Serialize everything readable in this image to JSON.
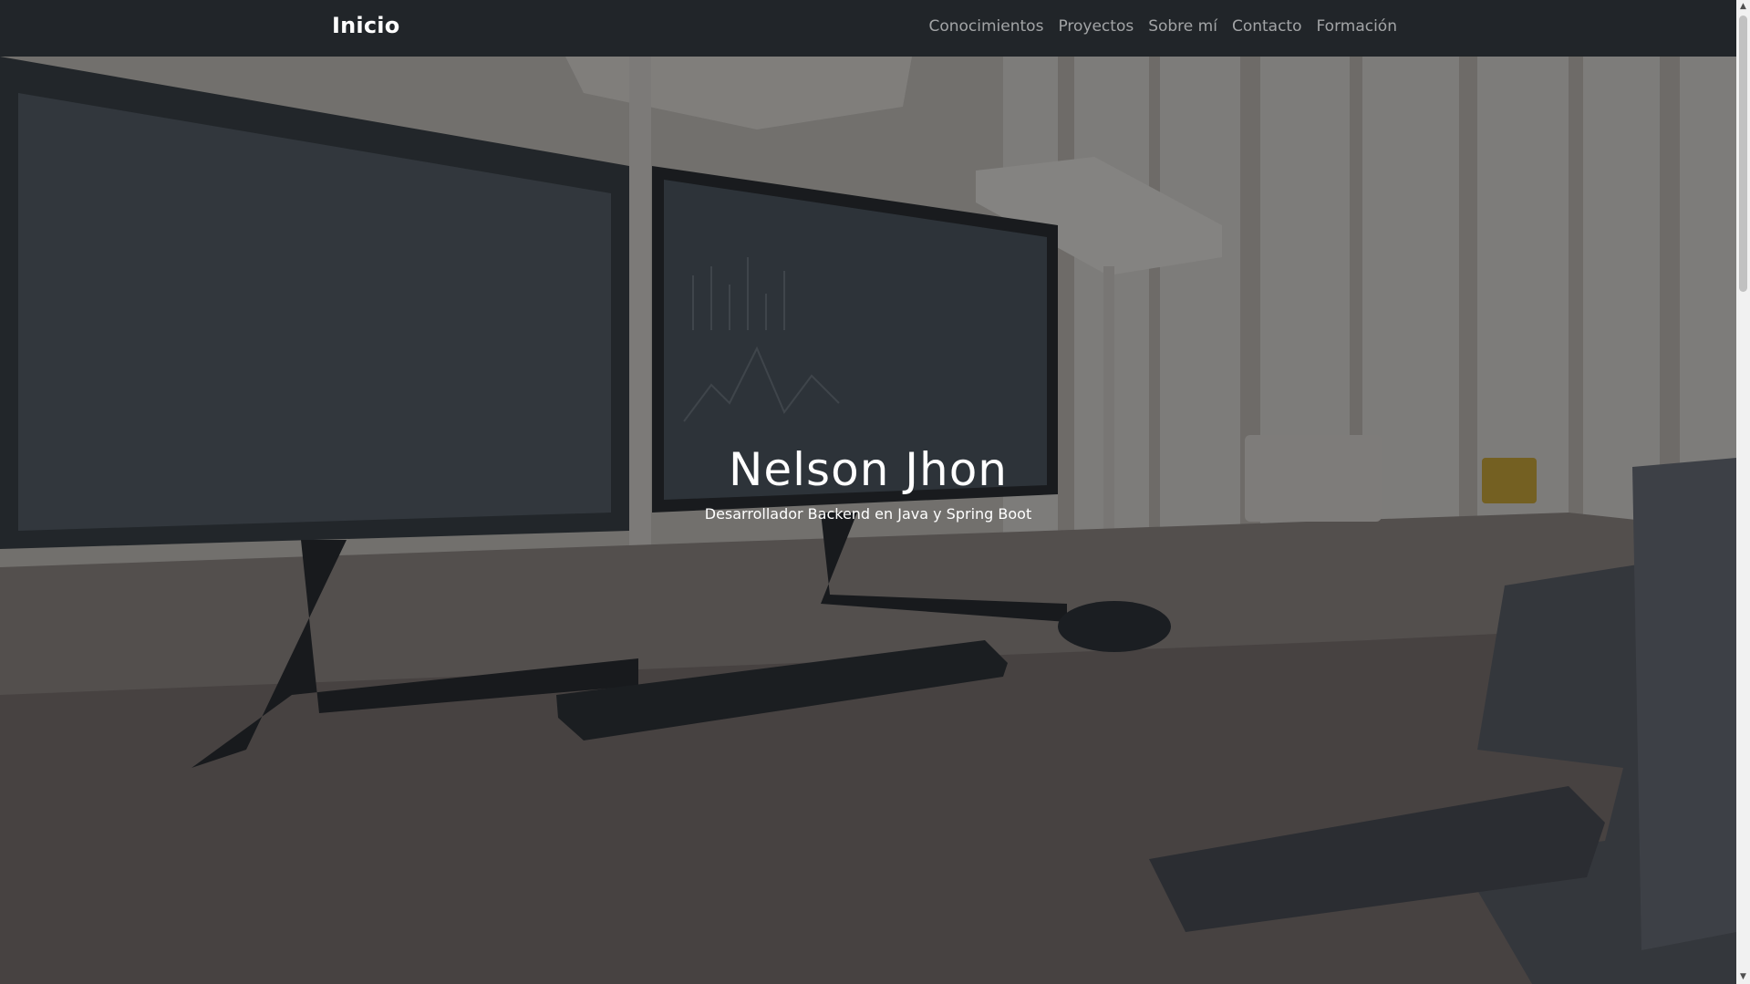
{
  "navbar": {
    "brand": "Inicio",
    "links": [
      "Conocimientos",
      "Proyectos",
      "Sobre mí",
      "Contacto",
      "Formación"
    ]
  },
  "hero": {
    "title": "Nelson Jhon",
    "subtitle": "Desarrollador Backend en Java y Spring Boot",
    "background_description_icon": "office-desk-photo"
  },
  "colors": {
    "navbar_bg": "#212529",
    "nav_link": "rgba(255,255,255,0.58)",
    "brand": "#ffffff",
    "hero_text": "#ffffff"
  }
}
